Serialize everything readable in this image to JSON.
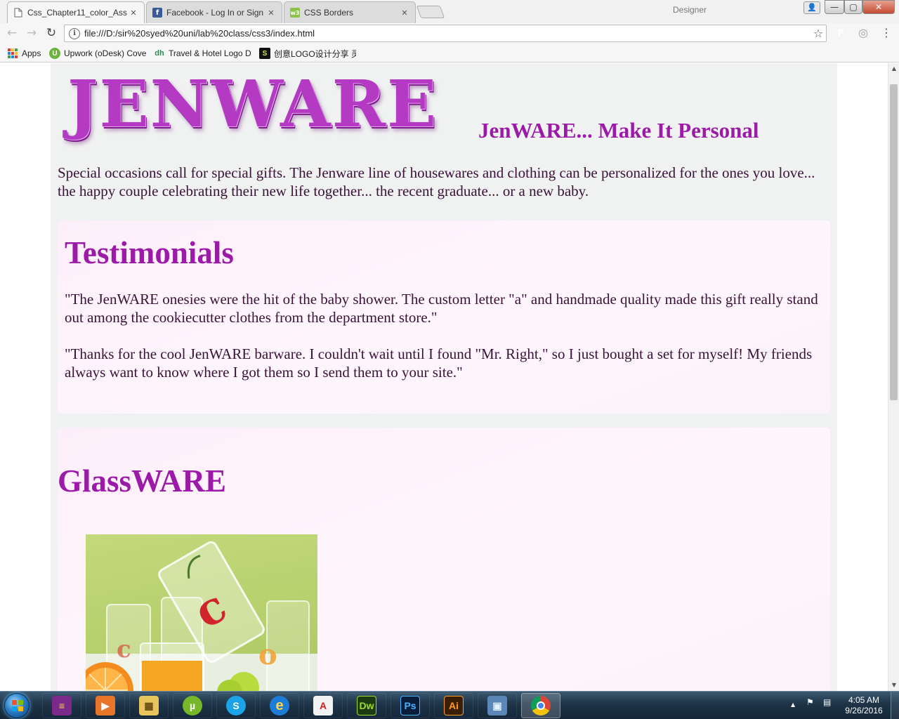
{
  "browser": {
    "tabs": [
      {
        "title": "Css_Chapter11_color_Ass",
        "close": "✕",
        "active": true
      },
      {
        "title": "Facebook - Log In or Sign",
        "close": "✕",
        "active": false
      },
      {
        "title": "CSS Borders",
        "close": "✕",
        "active": false
      }
    ],
    "profile_label": "Designer",
    "window_controls": {
      "minimize": "—",
      "maximize": "▢",
      "close": "✕"
    },
    "url": "file:///D:/sir%20syed%20uni/lab%20class/css3/index.html",
    "bookmarks": [
      {
        "label": "Apps",
        "icon": "apps-grid-icon"
      },
      {
        "label": "Upwork (oDesk) Cove",
        "icon": "upwork-icon"
      },
      {
        "label": "Travel & Hotel Logo D",
        "icon": "dh-icon"
      },
      {
        "label": "创意LOGO设计分享 灵",
        "icon": "s-icon"
      }
    ],
    "extensions": [
      {
        "icon": "pinterest-icon",
        "glyph": "P",
        "color": "#cb2027"
      },
      {
        "icon": "extension-circle-icon",
        "glyph": "◎",
        "color": "#9e9e9e"
      }
    ],
    "menu_glyph": "⋮"
  },
  "page": {
    "logo_text": "JENWARE",
    "tagline": "JenWARE... Make It Personal",
    "intro": "Special occasions call for special gifts. The Jenware line of housewares and clothing can be personalized for the ones you love... the happy couple celebrating their new life together... the recent graduate... or a new baby.",
    "testimonials": {
      "heading": "Testimonials",
      "quotes": [
        "\"The JenWARE onesies were the hit of the baby shower. The custom letter \"a\" and handmade quality made this gift really stand out among the cookiecutter clothes from the department store.\"",
        "\"Thanks for the cool JenWARE barware. I couldn't wait until I found \"Mr. Right,\" so I just bought a set for myself! My friends always want to know where I got them so I send them to your site.\""
      ]
    },
    "glassware": {
      "heading": "GlassWARE",
      "image_letters": [
        "c",
        "c",
        "o"
      ]
    }
  },
  "taskbar": {
    "apps": [
      {
        "name": "winrar",
        "glyph": "≡",
        "bg": "#7b2a8c",
        "fg": "#ffd34d"
      },
      {
        "name": "media-player",
        "glyph": "▶",
        "bg": "#e8752a",
        "fg": "#fff"
      },
      {
        "name": "file-explorer",
        "glyph": "▦",
        "bg": "#e9c35c",
        "fg": "#6a4b12"
      },
      {
        "name": "utorrent",
        "glyph": "µ",
        "bg": "#76b82a",
        "fg": "#fff"
      },
      {
        "name": "skype",
        "glyph": "S",
        "bg": "#1aa3e6",
        "fg": "#fff"
      },
      {
        "name": "internet-explorer",
        "glyph": "e",
        "bg": "#1d7cd6",
        "fg": "#ffd44f"
      },
      {
        "name": "acrobat",
        "glyph": "A",
        "bg": "#f2f2f2",
        "fg": "#d21f1f"
      },
      {
        "name": "dreamweaver",
        "glyph": "Dw",
        "bg": "#1d3b12",
        "fg": "#9ddc2a"
      },
      {
        "name": "photoshop",
        "glyph": "Ps",
        "bg": "#0a1d3b",
        "fg": "#4ab3ff"
      },
      {
        "name": "illustrator",
        "glyph": "Ai",
        "bg": "#3a1e06",
        "fg": "#ff9d1a"
      },
      {
        "name": "photo-viewer",
        "glyph": "▣",
        "bg": "#5a87b8",
        "fg": "#e6f1ff"
      },
      {
        "name": "chrome",
        "glyph": "◉",
        "bg": "#2b6cc4",
        "fg": "#fff"
      }
    ],
    "tray": {
      "arrow": "▲",
      "flag": "⚑",
      "network": "▤"
    },
    "time": "4:05 AM",
    "date": "9/26/2016"
  }
}
